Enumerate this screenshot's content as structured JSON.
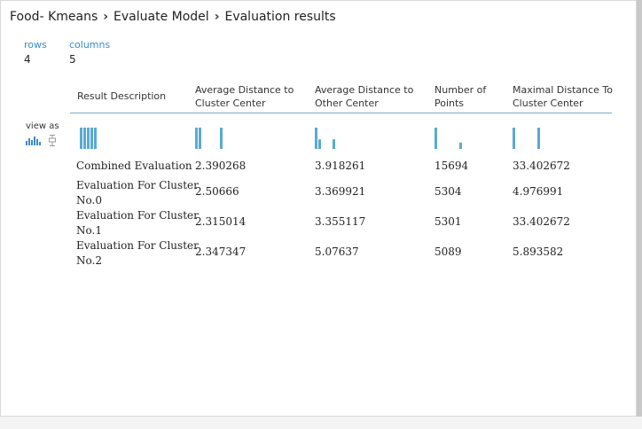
{
  "breadcrumb": {
    "items": [
      "Food- Kmeans",
      "Evaluate Model",
      "Evaluation results"
    ],
    "separator": "›"
  },
  "summary": {
    "rows_label": "rows",
    "rows_value": "4",
    "columns_label": "columns",
    "columns_value": "5"
  },
  "view_as": {
    "label": "view as",
    "histogram_icon": "histogram-icon",
    "boxplot_icon": "boxplot-icon"
  },
  "accent_color": "#5aaad0",
  "table": {
    "headers": [
      [
        "Result Description"
      ],
      [
        "Average Distance to",
        "Cluster Center"
      ],
      [
        "Average Distance to",
        "Other Center"
      ],
      [
        "Number of",
        "Points"
      ],
      [
        "Maximal Distance To",
        "Cluster Center"
      ]
    ],
    "rows": [
      {
        "desc": [
          "Combined Evaluation"
        ],
        "avg_center": "2.390268",
        "avg_other": "3.918261",
        "points": "15694",
        "max_dist": "33.402672"
      },
      {
        "desc": [
          "Evaluation For Cluster",
          "No.0"
        ],
        "avg_center": "2.50666",
        "avg_other": "3.369921",
        "points": "5304",
        "max_dist": "4.976991"
      },
      {
        "desc": [
          "Evaluation For Cluster",
          "No.1"
        ],
        "avg_center": "2.315014",
        "avg_other": "3.355117",
        "points": "5301",
        "max_dist": "33.402672"
      },
      {
        "desc": [
          "Evaluation For Cluster",
          "No.2"
        ],
        "avg_center": "2.347347",
        "avg_other": "5.07637",
        "points": "5089",
        "max_dist": "5.893582"
      }
    ]
  },
  "sparklines": [
    {
      "column": "Result Description",
      "bars": [
        1,
        1,
        1,
        1,
        1
      ]
    },
    {
      "column": "Average Distance to Cluster Center",
      "bars": [
        1,
        1,
        0,
        0,
        0,
        0,
        0,
        1
      ]
    },
    {
      "column": "Average Distance to Other Center",
      "bars": [
        1,
        0.45,
        0,
        0,
        0,
        0.45
      ]
    },
    {
      "column": "Number of Points",
      "bars": [
        1,
        0,
        0,
        0,
        0,
        0,
        0,
        0.3
      ]
    },
    {
      "column": "Maximal Distance To Cluster Center",
      "bars": [
        1,
        0,
        0,
        0,
        0,
        0,
        0,
        1
      ]
    }
  ]
}
